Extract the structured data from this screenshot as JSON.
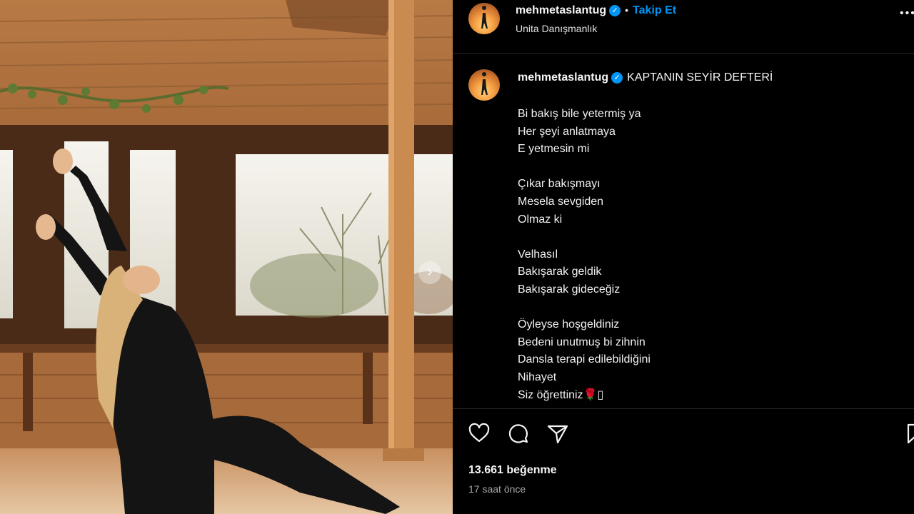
{
  "post": {
    "username": "mehmetaslantug",
    "follow_label": "Takip Et",
    "location": "Unita Danışmanlık",
    "caption_title": "KAPTANIN SEYİR DEFTERİ",
    "caption_stanzas": [
      [
        "Bi bakış bile yetermiş ya",
        "Her şeyi anlatmaya",
        "E yetmesin mi"
      ],
      [
        "Çıkar bakışmayı",
        "Mesela sevgiden",
        "Olmaz ki"
      ],
      [
        "Velhasıl",
        "Bakışarak geldik",
        "Bakışarak gideceğiz"
      ],
      [
        "Öyleyse hoşgeldiniz",
        "Bedeni unutmuş bi zihnin",
        "Dansla terapi edilebildiğini",
        "Nihayet",
        "Siz öğrettiniz🌹▯"
      ]
    ],
    "likes": "13.661 beğenme",
    "time_ago": "17 saat önce"
  },
  "icons": {
    "verified": "verified-badge-icon",
    "more": "more-options-icon",
    "like": "heart-icon",
    "comment": "comment-icon",
    "share": "send-icon",
    "save": "bookmark-icon",
    "next": "chevron-right-icon"
  },
  "colors": {
    "background": "#000000",
    "link_blue": "#0095f6",
    "muted": "#a8a8a8"
  }
}
